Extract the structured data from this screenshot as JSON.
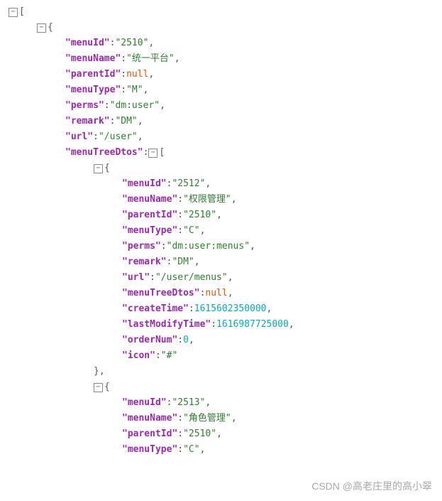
{
  "watermark": "CSDN @高老庄里的高小翠",
  "json": {
    "lines": [
      {
        "indent": 0,
        "toggle": true,
        "parts": [
          {
            "t": "punc",
            "v": "["
          }
        ]
      },
      {
        "indent": 1,
        "toggle": true,
        "parts": [
          {
            "t": "punc",
            "v": "{"
          }
        ]
      },
      {
        "indent": 2,
        "parts": [
          {
            "t": "key",
            "v": "\"menuId\""
          },
          {
            "t": "punc",
            "v": ":"
          },
          {
            "t": "str",
            "v": "\"2510\""
          },
          {
            "t": "punc",
            "v": ","
          }
        ]
      },
      {
        "indent": 2,
        "parts": [
          {
            "t": "key",
            "v": "\"menuName\""
          },
          {
            "t": "punc",
            "v": ":"
          },
          {
            "t": "str",
            "v": "\"统一平台\""
          },
          {
            "t": "punc",
            "v": ","
          }
        ]
      },
      {
        "indent": 2,
        "parts": [
          {
            "t": "key",
            "v": "\"parentId\""
          },
          {
            "t": "punc",
            "v": ":"
          },
          {
            "t": "nul",
            "v": "null"
          },
          {
            "t": "punc",
            "v": ","
          }
        ]
      },
      {
        "indent": 2,
        "parts": [
          {
            "t": "key",
            "v": "\"menuType\""
          },
          {
            "t": "punc",
            "v": ":"
          },
          {
            "t": "str",
            "v": "\"M\""
          },
          {
            "t": "punc",
            "v": ","
          }
        ]
      },
      {
        "indent": 2,
        "parts": [
          {
            "t": "key",
            "v": "\"perms\""
          },
          {
            "t": "punc",
            "v": ":"
          },
          {
            "t": "str",
            "v": "\"dm:user\""
          },
          {
            "t": "punc",
            "v": ","
          }
        ]
      },
      {
        "indent": 2,
        "parts": [
          {
            "t": "key",
            "v": "\"remark\""
          },
          {
            "t": "punc",
            "v": ":"
          },
          {
            "t": "str",
            "v": "\"DM\""
          },
          {
            "t": "punc",
            "v": ","
          }
        ]
      },
      {
        "indent": 2,
        "parts": [
          {
            "t": "key",
            "v": "\"url\""
          },
          {
            "t": "punc",
            "v": ":"
          },
          {
            "t": "str",
            "v": "\"/user\""
          },
          {
            "t": "punc",
            "v": ","
          }
        ]
      },
      {
        "indent": 2,
        "toggleAfter": true,
        "parts": [
          {
            "t": "key",
            "v": "\"menuTreeDtos\""
          },
          {
            "t": "punc",
            "v": ":"
          },
          {
            "t": "tog"
          },
          {
            "t": "punc",
            "v": "["
          }
        ]
      },
      {
        "indent": 3,
        "toggle": true,
        "parts": [
          {
            "t": "punc",
            "v": "{"
          }
        ]
      },
      {
        "indent": 4,
        "parts": [
          {
            "t": "key",
            "v": "\"menuId\""
          },
          {
            "t": "punc",
            "v": ":"
          },
          {
            "t": "str",
            "v": "\"2512\""
          },
          {
            "t": "punc",
            "v": ","
          }
        ]
      },
      {
        "indent": 4,
        "parts": [
          {
            "t": "key",
            "v": "\"menuName\""
          },
          {
            "t": "punc",
            "v": ":"
          },
          {
            "t": "str",
            "v": "\"权限管理\""
          },
          {
            "t": "punc",
            "v": ","
          }
        ]
      },
      {
        "indent": 4,
        "parts": [
          {
            "t": "key",
            "v": "\"parentId\""
          },
          {
            "t": "punc",
            "v": ":"
          },
          {
            "t": "str",
            "v": "\"2510\""
          },
          {
            "t": "punc",
            "v": ","
          }
        ]
      },
      {
        "indent": 4,
        "parts": [
          {
            "t": "key",
            "v": "\"menuType\""
          },
          {
            "t": "punc",
            "v": ":"
          },
          {
            "t": "str",
            "v": "\"C\""
          },
          {
            "t": "punc",
            "v": ","
          }
        ]
      },
      {
        "indent": 4,
        "parts": [
          {
            "t": "key",
            "v": "\"perms\""
          },
          {
            "t": "punc",
            "v": ":"
          },
          {
            "t": "str",
            "v": "\"dm:user:menus\""
          },
          {
            "t": "punc",
            "v": ","
          }
        ]
      },
      {
        "indent": 4,
        "parts": [
          {
            "t": "key",
            "v": "\"remark\""
          },
          {
            "t": "punc",
            "v": ":"
          },
          {
            "t": "str",
            "v": "\"DM\""
          },
          {
            "t": "punc",
            "v": ","
          }
        ]
      },
      {
        "indent": 4,
        "parts": [
          {
            "t": "key",
            "v": "\"url\""
          },
          {
            "t": "punc",
            "v": ":"
          },
          {
            "t": "str",
            "v": "\"/user/menus\""
          },
          {
            "t": "punc",
            "v": ","
          }
        ]
      },
      {
        "indent": 4,
        "parts": [
          {
            "t": "key",
            "v": "\"menuTreeDtos\""
          },
          {
            "t": "punc",
            "v": ":"
          },
          {
            "t": "nul",
            "v": "null"
          },
          {
            "t": "punc",
            "v": ","
          }
        ]
      },
      {
        "indent": 4,
        "parts": [
          {
            "t": "key",
            "v": "\"createTime\""
          },
          {
            "t": "punc",
            "v": ":"
          },
          {
            "t": "num",
            "v": "1615602350000"
          },
          {
            "t": "punc",
            "v": ","
          }
        ]
      },
      {
        "indent": 4,
        "parts": [
          {
            "t": "key",
            "v": "\"lastModifyTime\""
          },
          {
            "t": "punc",
            "v": ":"
          },
          {
            "t": "num",
            "v": "1616987725000"
          },
          {
            "t": "punc",
            "v": ","
          }
        ]
      },
      {
        "indent": 4,
        "parts": [
          {
            "t": "key",
            "v": "\"orderNum\""
          },
          {
            "t": "punc",
            "v": ":"
          },
          {
            "t": "num",
            "v": "0"
          },
          {
            "t": "punc",
            "v": ","
          }
        ]
      },
      {
        "indent": 4,
        "parts": [
          {
            "t": "key",
            "v": "\"icon\""
          },
          {
            "t": "punc",
            "v": ":"
          },
          {
            "t": "str",
            "v": "\"#\""
          }
        ]
      },
      {
        "indent": 3,
        "parts": [
          {
            "t": "punc",
            "v": "},"
          }
        ]
      },
      {
        "indent": 3,
        "toggle": true,
        "parts": [
          {
            "t": "punc",
            "v": "{"
          }
        ]
      },
      {
        "indent": 4,
        "parts": [
          {
            "t": "key",
            "v": "\"menuId\""
          },
          {
            "t": "punc",
            "v": ":"
          },
          {
            "t": "str",
            "v": "\"2513\""
          },
          {
            "t": "punc",
            "v": ","
          }
        ]
      },
      {
        "indent": 4,
        "parts": [
          {
            "t": "key",
            "v": "\"menuName\""
          },
          {
            "t": "punc",
            "v": ":"
          },
          {
            "t": "str",
            "v": "\"角色管理\""
          },
          {
            "t": "punc",
            "v": ","
          }
        ]
      },
      {
        "indent": 4,
        "parts": [
          {
            "t": "key",
            "v": "\"parentId\""
          },
          {
            "t": "punc",
            "v": ":"
          },
          {
            "t": "str",
            "v": "\"2510\""
          },
          {
            "t": "punc",
            "v": ","
          }
        ]
      },
      {
        "indent": 4,
        "parts": [
          {
            "t": "key",
            "v": "\"menuType\""
          },
          {
            "t": "punc",
            "v": ":"
          },
          {
            "t": "str",
            "v": "\"C\""
          },
          {
            "t": "punc",
            "v": ","
          }
        ]
      }
    ]
  }
}
